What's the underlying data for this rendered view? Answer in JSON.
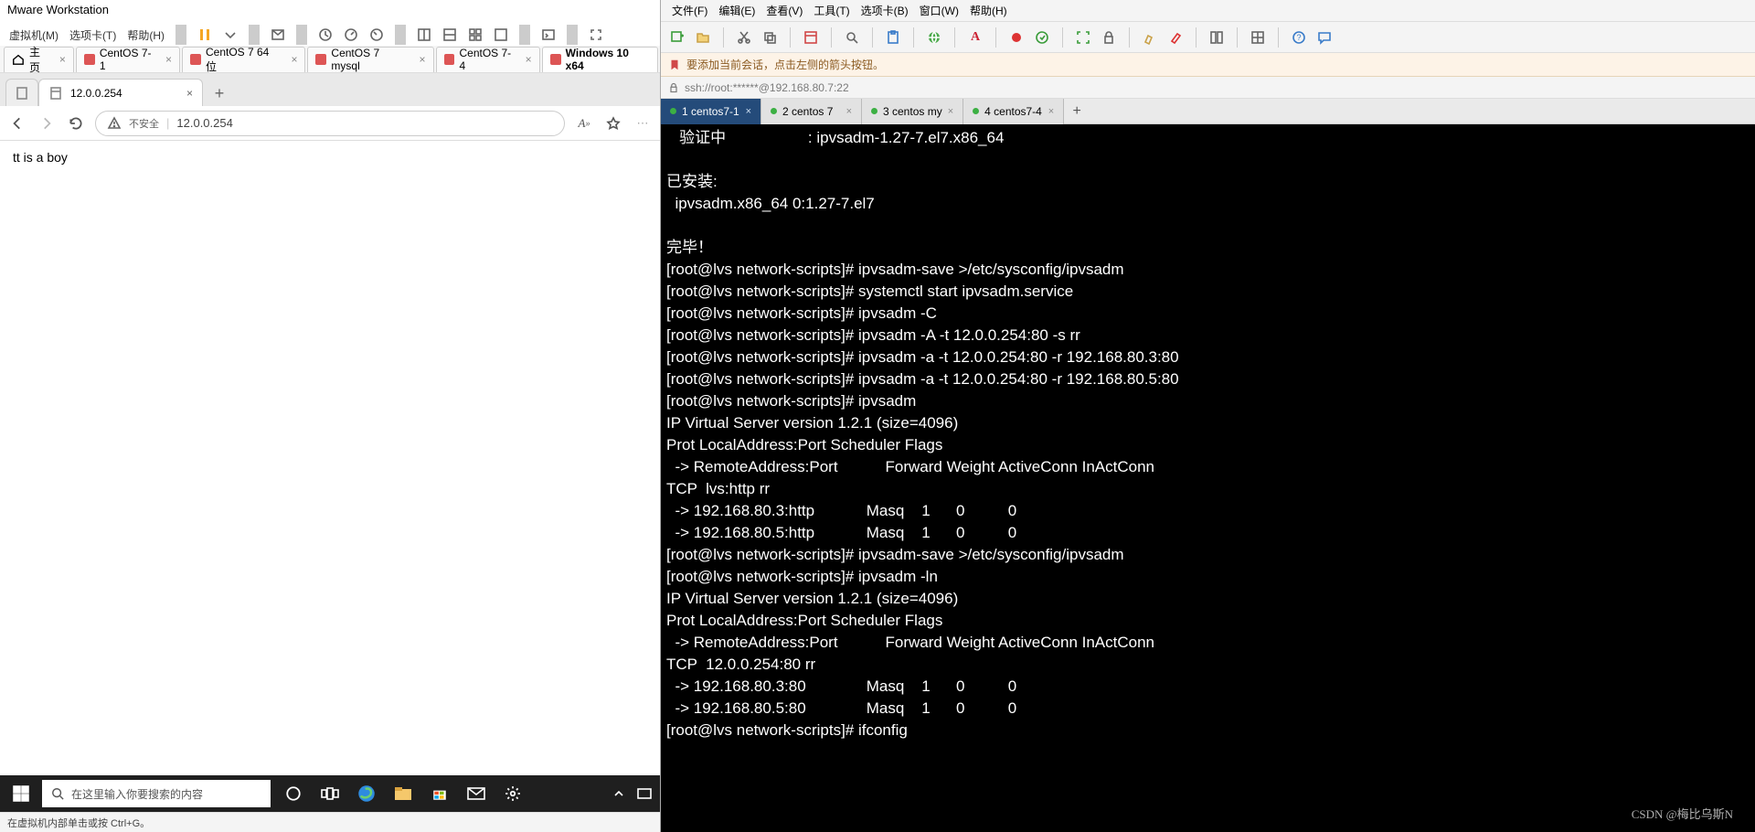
{
  "vmware": {
    "title": "Mware Workstation",
    "menu": [
      "虚拟机(M)",
      "选项卡(T)",
      "帮助(H)"
    ],
    "tabs": [
      {
        "label": "主页",
        "home": true
      },
      {
        "label": "CentOS 7-1"
      },
      {
        "label": "CentOS 7 64 位"
      },
      {
        "label": "CentOS 7 mysql"
      },
      {
        "label": "CentOS 7-4"
      },
      {
        "label": "Windows 10 x64",
        "active": true
      }
    ],
    "status": "在虚拟机内部单击或按 Ctrl+G。"
  },
  "browser": {
    "tab_label": "12.0.0.254",
    "insecure": "不安全",
    "url": "12.0.0.254",
    "body": "tt is a boy"
  },
  "windows": {
    "search_placeholder": "在这里输入你要搜索的内容"
  },
  "term_app": {
    "menu": [
      "文件(F)",
      "编辑(E)",
      "查看(V)",
      "工具(T)",
      "选项卡(B)",
      "窗口(W)",
      "帮助(H)"
    ],
    "hint": "要添加当前会话，点击左侧的箭头按钮。",
    "conn": "ssh://root:******@192.168.80.7:22",
    "tabs": [
      {
        "label": "1 centos7-1",
        "active": true
      },
      {
        "label": "2 centos 7"
      },
      {
        "label": "3 centos my"
      },
      {
        "label": "4 centos7-4"
      }
    ],
    "output": "   验证中                   : ipvsadm-1.27-7.el7.x86_64\n\n已安装:\n  ipvsadm.x86_64 0:1.27-7.el7\n\n完毕！\n[root@lvs network-scripts]# ipvsadm-save >/etc/sysconfig/ipvsadm\n[root@lvs network-scripts]# systemctl start ipvsadm.service\n[root@lvs network-scripts]# ipvsadm -C\n[root@lvs network-scripts]# ipvsadm -A -t 12.0.0.254:80 -s rr\n[root@lvs network-scripts]# ipvsadm -a -t 12.0.0.254:80 -r 192.168.80.3:80\n[root@lvs network-scripts]# ipvsadm -a -t 12.0.0.254:80 -r 192.168.80.5:80\n[root@lvs network-scripts]# ipvsadm\nIP Virtual Server version 1.2.1 (size=4096)\nProt LocalAddress:Port Scheduler Flags\n  -> RemoteAddress:Port           Forward Weight ActiveConn InActConn\nTCP  lvs:http rr\n  -> 192.168.80.3:http            Masq    1      0          0\n  -> 192.168.80.5:http            Masq    1      0          0\n[root@lvs network-scripts]# ipvsadm-save >/etc/sysconfig/ipvsadm\n[root@lvs network-scripts]# ipvsadm -ln\nIP Virtual Server version 1.2.1 (size=4096)\nProt LocalAddress:Port Scheduler Flags\n  -> RemoteAddress:Port           Forward Weight ActiveConn InActConn\nTCP  12.0.0.254:80 rr\n  -> 192.168.80.3:80              Masq    1      0          0\n  -> 192.168.80.5:80              Masq    1      0          0\n[root@lvs network-scripts]# ifconfig",
    "watermark": "CSDN @梅比乌斯N"
  }
}
